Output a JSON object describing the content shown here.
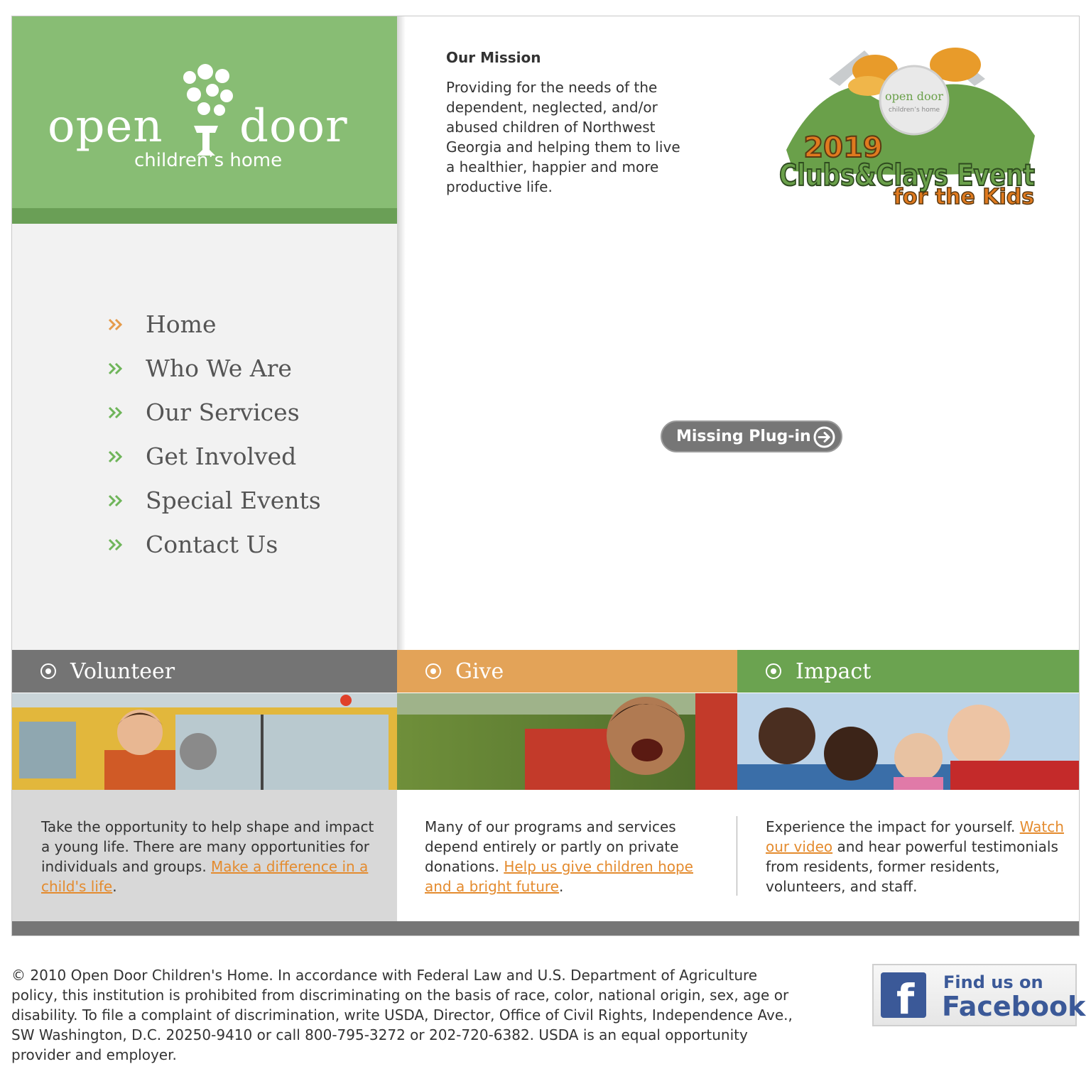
{
  "logo": {
    "word_left": "open",
    "word_right": "door",
    "subtitle": "children’s home"
  },
  "nav": {
    "items": [
      {
        "label": "Home",
        "active": true
      },
      {
        "label": "Who We Are",
        "active": false
      },
      {
        "label": "Our Services",
        "active": false
      },
      {
        "label": "Get Involved",
        "active": false
      },
      {
        "label": "Special Events",
        "active": false
      },
      {
        "label": "Contact Us",
        "active": false
      }
    ]
  },
  "mission": {
    "title": "Our Mission",
    "text": "Providing for the needs of the dependent, neglected, and/or abused children of Northwest Georgia and helping them to live a healthier, happier and more productive life."
  },
  "event_logo": {
    "line1": "2019",
    "line2": "Clubs&Clays Event",
    "line3": "for the Kids",
    "badge_left": "open",
    "badge_right": "door",
    "badge_sub": "children’s home"
  },
  "plugin": {
    "label": "Missing Plug-in"
  },
  "tiles": {
    "volunteer": {
      "title": "Volunteer",
      "text": "Take the opportunity to help shape and impact a young life. There are many opportunities for individuals and groups.",
      "link": "Make a difference in a child's life",
      "after": "."
    },
    "give": {
      "title": "Give",
      "text": "Many of our programs and services depend entirely or partly on private donations.",
      "link": "Help us give children hope and a bright future",
      "after": "."
    },
    "impact": {
      "title": "Impact",
      "before": "Experience the impact for yourself.",
      "link": "Watch our video",
      "text": "and hear powerful testimonials from residents, former residents, volunteers, and staff."
    }
  },
  "footer": {
    "text": "© 2010 Open Door Children's Home. In accordance with Federal Law and U.S. Department of Agriculture policy, this institution is prohibited from discriminating on the basis of race, color, national origin, sex, age or disability. To file a complaint of discrimination, write USDA, Director, Office of Civil Rights, Independence Ave., SW Washington, D.C. 20250-9410 or call 800-795-3272 or 202-720-6382. USDA is an equal opportunity provider and employer."
  },
  "facebook": {
    "find": "Find us on",
    "name": "Facebook",
    "letter": "f"
  },
  "colors": {
    "green_light": "#88bd74",
    "green_dark": "#6a9f56",
    "orange": "#e3a358",
    "gray_bar": "#747474",
    "link": "#e48b2e",
    "facebook_blue": "#3b5998"
  },
  "icons": {
    "nav_arrow": "chevron-double-right-icon",
    "tile_radio": "radio-dot-icon",
    "plugin_arrow": "arrow-circle-right-icon"
  }
}
